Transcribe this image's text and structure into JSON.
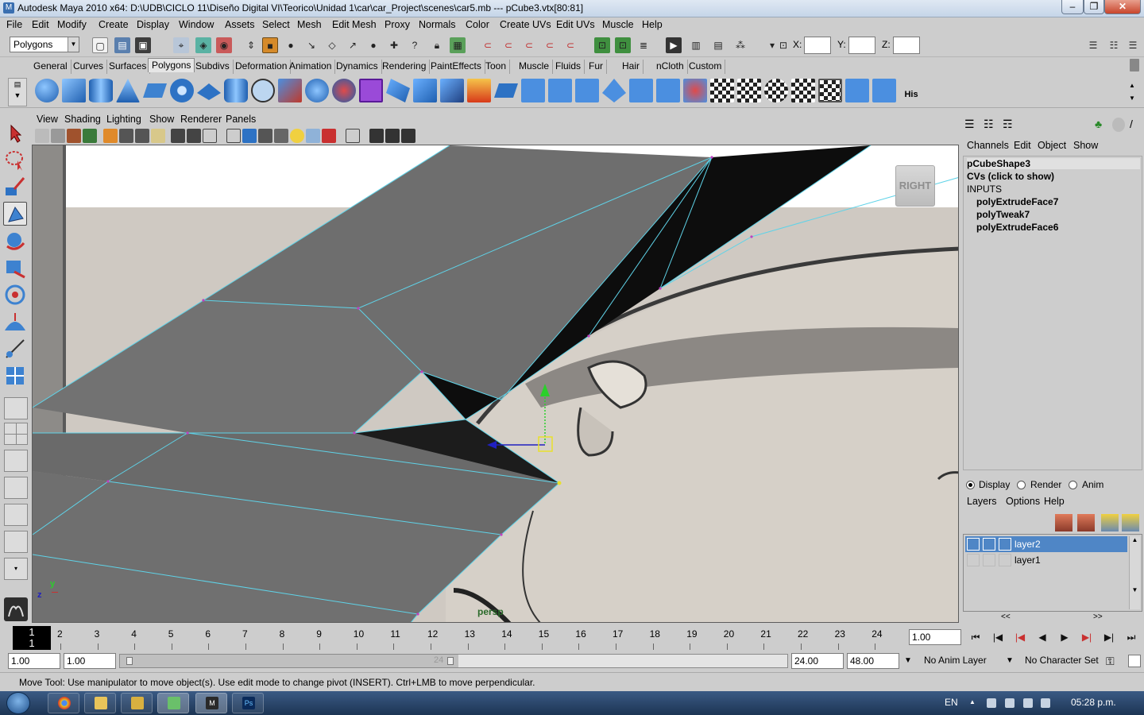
{
  "window": {
    "title": "Autodesk Maya 2010 x64: D:\\UDB\\CICLO 11\\Diseño Digital VI\\Teorico\\Unidad 1\\car\\car_Project\\scenes\\car5.mb   ---   pCube3.vtx[80:81]",
    "minimize": "–",
    "restore": "❐",
    "close": "✕"
  },
  "menubar": [
    "File",
    "Edit",
    "Modify",
    "Create",
    "Display",
    "Window",
    "Assets",
    "Select",
    "Mesh",
    "Edit Mesh",
    "Proxy",
    "Normals",
    "Color",
    "Create UVs",
    "Edit UVs",
    "Muscle",
    "Help"
  ],
  "statusline": {
    "mode": "Polygons",
    "coord_labels": [
      "X:",
      "Y:",
      "Z:"
    ]
  },
  "shelf": {
    "tabs": [
      "General",
      "Curves",
      "Surfaces",
      "Polygons",
      "Subdivs",
      "Deformation",
      "Animation",
      "Dynamics",
      "Rendering",
      "PaintEffects",
      "Toon",
      "Muscle",
      "Fluids",
      "Fur",
      "Hair",
      "nCloth",
      "Custom"
    ],
    "active_tab": "Polygons",
    "last_icon_label": "His"
  },
  "panel": {
    "menu": [
      "View",
      "Shading",
      "Lighting",
      "Show",
      "Renderer",
      "Panels"
    ],
    "viewcube_label": "RIGHT",
    "camera_name": "persp",
    "axis_labels": {
      "y": "y",
      "z": "z",
      "x": "x"
    }
  },
  "channelbox": {
    "menu": [
      "Channels",
      "Edit",
      "Object",
      "Show"
    ],
    "object": "pCubeShape3",
    "cvs": "CVs (click to show)",
    "inputs_header": "INPUTS",
    "inputs": [
      "polyExtrudeFace7",
      "polyTweak7",
      "polyExtrudeFace6"
    ]
  },
  "layers": {
    "modes": [
      "Display",
      "Render",
      "Anim"
    ],
    "active_mode": "Display",
    "menu": [
      "Layers",
      "Options",
      "Help"
    ],
    "items": [
      {
        "name": "layer2",
        "selected": true
      },
      {
        "name": "layer1",
        "selected": false
      }
    ],
    "scroll_left": "<<",
    "scroll_right": ">>"
  },
  "timeslider": {
    "current_frame": "1",
    "ticks": [
      "2",
      "3",
      "4",
      "5",
      "6",
      "7",
      "8",
      "9",
      "10",
      "11",
      "12",
      "13",
      "14",
      "15",
      "16",
      "17",
      "18",
      "19",
      "20",
      "21",
      "22",
      "23",
      "24"
    ],
    "current_time": "1.00"
  },
  "range": {
    "start": "1.00",
    "playback_start": "1.00",
    "slider_mid_label": "24",
    "playback_end": "24.00",
    "end": "48.00",
    "anim_layer": "No Anim Layer",
    "character_set": "No Character Set"
  },
  "helpline": "Move Tool: Use manipulator to move object(s). Use edit mode to change pivot (INSERT).  Ctrl+LMB to move perpendicular.",
  "taskbar": {
    "language": "EN",
    "clock": "05:28 p.m."
  },
  "colors": {
    "ui_gray": "#cdcdcd",
    "selection_blue": "#4f86c6",
    "wireframe_cyan": "#5fd3e8",
    "mesh_gray": "#6e6e6e"
  }
}
